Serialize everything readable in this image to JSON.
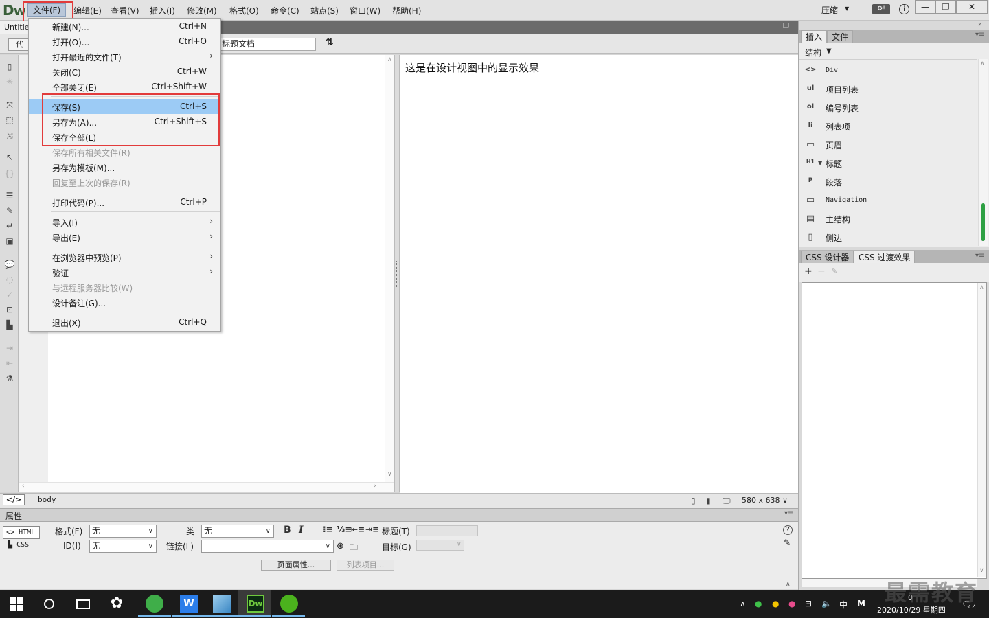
{
  "app": {
    "logo": "Dw",
    "menus": [
      "文件(F)",
      "编辑(E)",
      "查看(V)",
      "插入(I)",
      "修改(M)",
      "格式(O)",
      "命令(C)",
      "站点(S)",
      "窗口(W)",
      "帮助(H)"
    ],
    "layout_label": "压缩",
    "window_controls": [
      "—",
      "❐",
      "✕"
    ]
  },
  "document": {
    "tab_name": "Untitled",
    "code_button_label": "代码",
    "title_value": "标题文档",
    "design_text": "这是在设计视图中的显示效果"
  },
  "file_menu": {
    "items": [
      {
        "label": "新建(N)...",
        "shortcut": "Ctrl+N"
      },
      {
        "label": "打开(O)...",
        "shortcut": "Ctrl+O"
      },
      {
        "label": "打开最近的文件(T)",
        "shortcut": "",
        "submenu": "›"
      },
      {
        "label": "关闭(C)",
        "shortcut": "Ctrl+W"
      },
      {
        "label": "全部关闭(E)",
        "shortcut": "Ctrl+Shift+W"
      },
      {
        "label": "保存(S)",
        "shortcut": "Ctrl+S"
      },
      {
        "label": "另存为(A)...",
        "shortcut": "Ctrl+Shift+S"
      },
      {
        "label": "保存全部(L)",
        "shortcut": ""
      },
      {
        "label": "保存所有相关文件(R)",
        "shortcut": ""
      },
      {
        "label": "另存为模板(M)...",
        "shortcut": ""
      },
      {
        "label": "回复至上次的保存(R)",
        "shortcut": ""
      },
      {
        "label": "打印代码(P)...",
        "shortcut": "Ctrl+P"
      },
      {
        "label": "导入(I)",
        "shortcut": "",
        "submenu": "›"
      },
      {
        "label": "导出(E)",
        "shortcut": "",
        "submenu": "›"
      },
      {
        "label": "在浏览器中预览(P)",
        "shortcut": "",
        "submenu": "›"
      },
      {
        "label": "验证",
        "shortcut": "",
        "submenu": "›"
      },
      {
        "label": "与远程服务器比较(W)",
        "shortcut": ""
      },
      {
        "label": "设计备注(G)...",
        "shortcut": ""
      },
      {
        "label": "退出(X)",
        "shortcut": "Ctrl+Q"
      }
    ]
  },
  "statusbar": {
    "tag_icon": "</>",
    "tag": "body",
    "size": "580 x 638"
  },
  "properties": {
    "title": "属性",
    "html_label": "HTML",
    "css_label": "CSS",
    "format_label": "格式(F)",
    "format_value": "无",
    "id_label": "ID(I)",
    "id_value": "无",
    "class_label": "类",
    "class_value": "无",
    "link_label": "链接(L)",
    "title_label": "标题(T)",
    "target_label": "目标(G)",
    "page_props_button": "页面属性...",
    "list_items_button": "列表项目..."
  },
  "insert_panel": {
    "tabs": [
      "插入",
      "文件"
    ],
    "category": "结构",
    "items": [
      {
        "icon": "<>",
        "label": "Div"
      },
      {
        "icon": "ul",
        "label": "项目列表"
      },
      {
        "icon": "ol",
        "label": "编号列表"
      },
      {
        "icon": "li",
        "label": "列表项"
      },
      {
        "icon": "▭",
        "label": "页眉"
      },
      {
        "icon": "H1",
        "label": "标题"
      },
      {
        "icon": "P",
        "label": "段落"
      },
      {
        "icon": "▭",
        "label": "Navigation"
      },
      {
        "icon": "▤",
        "label": "主结构"
      },
      {
        "icon": "▯",
        "label": "侧边"
      }
    ]
  },
  "css_panel": {
    "tabs": [
      "CSS 设计器",
      "CSS 过渡效果"
    ]
  },
  "taskbar": {
    "clock_time": "0",
    "clock_date": "2020/10/29 星期四",
    "ime": "中",
    "notifications": "4"
  },
  "watermark": "最需教育"
}
